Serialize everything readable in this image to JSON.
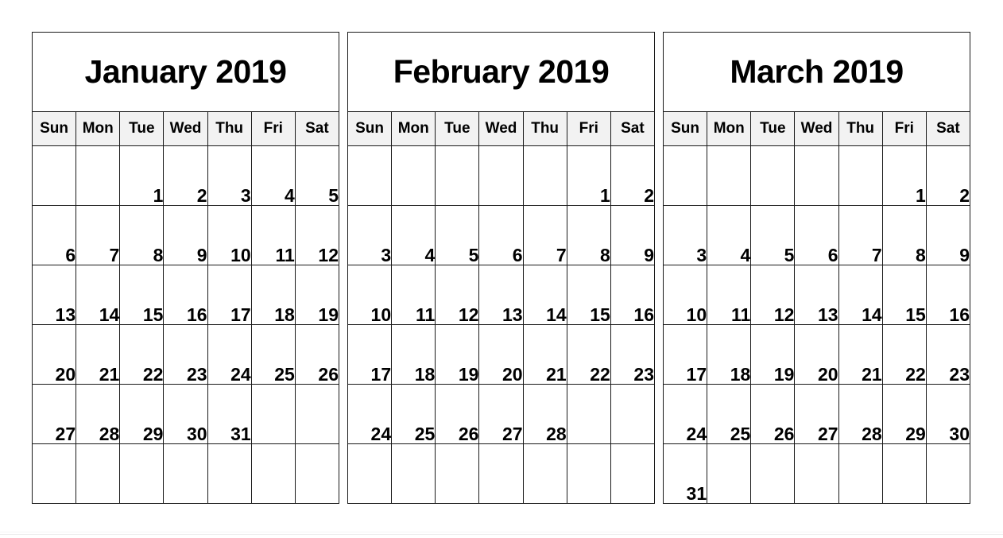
{
  "page": {
    "background_color": "#ffffff",
    "border_color": "#1a1a1a",
    "header_background_color": "#f2f2f2",
    "text_color": "#000000"
  },
  "weekday_headers": [
    "Sun",
    "Mon",
    "Tue",
    "Wed",
    "Thu",
    "Fri",
    "Sat"
  ],
  "months": [
    {
      "title": "January 2019",
      "name": "January",
      "year": "2019",
      "weeks": [
        [
          "",
          "",
          "1",
          "2",
          "3",
          "4",
          "5"
        ],
        [
          "6",
          "7",
          "8",
          "9",
          "10",
          "11",
          "12"
        ],
        [
          "13",
          "14",
          "15",
          "16",
          "17",
          "18",
          "19"
        ],
        [
          "20",
          "21",
          "22",
          "23",
          "24",
          "25",
          "26"
        ],
        [
          "27",
          "28",
          "29",
          "30",
          "31",
          "",
          ""
        ],
        [
          "",
          "",
          "",
          "",
          "",
          "",
          ""
        ]
      ]
    },
    {
      "title": "February 2019",
      "name": "February",
      "year": "2019",
      "weeks": [
        [
          "",
          "",
          "",
          "",
          "",
          "1",
          "2"
        ],
        [
          "3",
          "4",
          "5",
          "6",
          "7",
          "8",
          "9"
        ],
        [
          "10",
          "11",
          "12",
          "13",
          "14",
          "15",
          "16"
        ],
        [
          "17",
          "18",
          "19",
          "20",
          "21",
          "22",
          "23"
        ],
        [
          "24",
          "25",
          "26",
          "27",
          "28",
          "",
          ""
        ],
        [
          "",
          "",
          "",
          "",
          "",
          "",
          ""
        ]
      ]
    },
    {
      "title": "March 2019",
      "name": "March",
      "year": "2019",
      "weeks": [
        [
          "",
          "",
          "",
          "",
          "",
          "1",
          "2"
        ],
        [
          "3",
          "4",
          "5",
          "6",
          "7",
          "8",
          "9"
        ],
        [
          "10",
          "11",
          "12",
          "13",
          "14",
          "15",
          "16"
        ],
        [
          "17",
          "18",
          "19",
          "20",
          "21",
          "22",
          "23"
        ],
        [
          "24",
          "25",
          "26",
          "27",
          "28",
          "29",
          "30"
        ],
        [
          "31",
          "",
          "",
          "",
          "",
          "",
          ""
        ]
      ]
    }
  ]
}
